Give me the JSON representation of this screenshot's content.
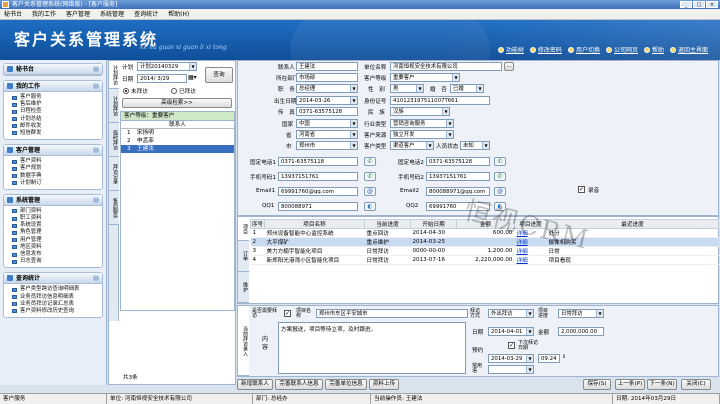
{
  "window": {
    "title": "客户关系管理系统(网络版) - [客户服务]",
    "controls": [
      "_",
      "□",
      "×"
    ]
  },
  "menu": [
    "秘书台",
    "我的工作",
    "客户管理",
    "系统管理",
    "查询统计",
    "帮助(H)"
  ],
  "banner": {
    "title": "客户关系管理系统",
    "subtitle": "ke hu guan xi guan li xi tong",
    "links": [
      "功能树",
      "修改密码",
      "用户切换",
      "公司网页",
      "帮助",
      "退回主界面"
    ]
  },
  "nav": [
    {
      "title": "秘书台",
      "items": []
    },
    {
      "title": "我的工作",
      "items": [
        "客户服务",
        "售后维护",
        "日程检查",
        "计划总结",
        "邮件收发",
        "短信群发"
      ]
    },
    {
      "title": "客户管理",
      "items": [
        "客户资料",
        "客户规划",
        "数据字典",
        "计划制订"
      ]
    },
    {
      "title": "系统管理",
      "items": [
        "部门资料",
        "职工资料",
        "系统设置",
        "角色管理",
        "用户管理",
        "地区资料",
        "信息发布",
        "日志查询"
      ]
    },
    {
      "title": "查询统计",
      "items": [
        "客户类型跨访查询明细表",
        "业务员拜访信息明细表",
        "业务员拜访记录汇总表",
        "客户资料修改历史查询"
      ]
    }
  ],
  "mid": {
    "vtabs": [
      "计划拜访",
      "计划拜访",
      "临时拜访",
      "拜访记录",
      "售后服务"
    ],
    "plan_label": "计划",
    "plan_value": "计划20140329",
    "date_label": "日期",
    "date_value": "2014/ 3/29",
    "query_btn": "查询",
    "radio_unvisited": "未拜访",
    "radio_visited": "已拜访",
    "advanced_btn": "高级检索>>",
    "level_header": "客户等级：重要客户",
    "col_contact": "联系人",
    "rows": [
      {
        "n": "1",
        "name": "宋扬明"
      },
      {
        "n": "2",
        "name": "申孟菲"
      },
      {
        "n": "3",
        "name": "王建法"
      }
    ],
    "count": "共3条"
  },
  "form": {
    "contact_label": "联系人",
    "contact": "王建法",
    "company_label": "单位名称",
    "company": "河南恒视安全技术有限公司",
    "dept_label": "所在部门",
    "dept": "市场部",
    "level_label": "客户等级",
    "level": "重要客户",
    "title_label": "职　务",
    "title": "总经理",
    "gender_label": "性　别",
    "gender": "男",
    "marital_label": "婚　否",
    "marital": "已婚",
    "birth_label": "出生日期",
    "birth": "2014-03-26",
    "id_label": "身份证号",
    "id": "410123197511007T661",
    "fax_label": "传　真",
    "fax": "0371-63575128",
    "ethnic_label": "民　族",
    "ethnic": "汉族",
    "country_label": "国家",
    "country": "中国",
    "industry_label": "行业类型",
    "industry": "营销咨询服务",
    "province_label": "省",
    "province": "河南省",
    "source_label": "客户来源",
    "source": "独立开发",
    "city_label": "市",
    "city": "郑州市",
    "type_label": "客户类型",
    "type": "渠道客户",
    "status_label": "人员状态",
    "status": "未知",
    "phone1_label": "固定电话1",
    "phone1": "0371-63575118",
    "phone2_label": "固定电话2",
    "phone2": "0371-63575128",
    "mobile1_label": "手机号码1",
    "mobile1": "13937151761",
    "mobile2_label": "手机号码2",
    "mobile2": "13937151761",
    "email1_label": "Email1",
    "email1": "69991760@qq.com",
    "email2_label": "Email2",
    "email2": "800088971@qq.com",
    "qq1_label": "QQ1",
    "qq1": "800088971",
    "qq2_label": "QQ2",
    "qq2": "69991760",
    "record_label": "录音"
  },
  "grid": {
    "vtabs": [
      "项目",
      "订单",
      "维护"
    ],
    "headers": [
      "序号",
      "项目名称",
      "当前进度",
      "开始日期",
      "金额",
      "项目进度",
      "最近进度"
    ],
    "rows": [
      {
        "n": "1",
        "name": "郑州设备智能中心监控系统",
        "stage": "重点回访",
        "date": "2014-04-30",
        "amt": "600.00",
        "link": "详细",
        "last": "处分"
      },
      {
        "n": "2",
        "name": "大平煤矿",
        "stage": "重点维护",
        "date": "2014-03-25",
        "amt": "",
        "link": "详细",
        "last": "摄像机购买"
      },
      {
        "n": "3",
        "name": "美力方楠宇智能化项目",
        "stage": "日常拜访",
        "date": "0000-00-00",
        "amt": "1,200.00",
        "link": "详细",
        "last": "日常"
      },
      {
        "n": "4",
        "name": "新郑阳光港湾小区智能化项目",
        "stage": "日常拜访",
        "date": "2013-07-16",
        "amt": "2,220,000.00",
        "link": "详细",
        "last": "项目看现"
      }
    ]
  },
  "visit": {
    "vtab": "当前拜访录入",
    "need_label": "是否需要拜访",
    "proj_name_label": "项目名称",
    "proj_name": "郑州市东区平安城市",
    "visit_way_label": "拜访方式",
    "visit_way": "外出拜访",
    "stage_label": "项目进度",
    "stage": "日常拜访",
    "content_label": "内容",
    "content": "方案报送，项目等待立项，及时跟进。",
    "date_label": "日期",
    "date": "2014-04-01",
    "amount_label": "金额",
    "amount": "2,000,000.00",
    "next_label": "下次拜访日期",
    "next_date": "2014-03-29",
    "next_time": "09:24",
    "reserve_label": "预约",
    "common_label": "常用语"
  },
  "buttons_left": [
    "新增联系人",
    "完善联系人信息",
    "完善单位信息",
    "资料上传"
  ],
  "buttons_right": [
    "保存(S)",
    "上一条(P)",
    "下一条(N)",
    "关闭(C)"
  ],
  "statusbar": {
    "left": "客户服务",
    "company": "单位: 河南恒视安全技术有限公司",
    "dept": "部门: 总经办",
    "user": "当前操作员: 王建法",
    "date": "日期: 2014年03月29日"
  },
  "watermark": "恒视CRM"
}
